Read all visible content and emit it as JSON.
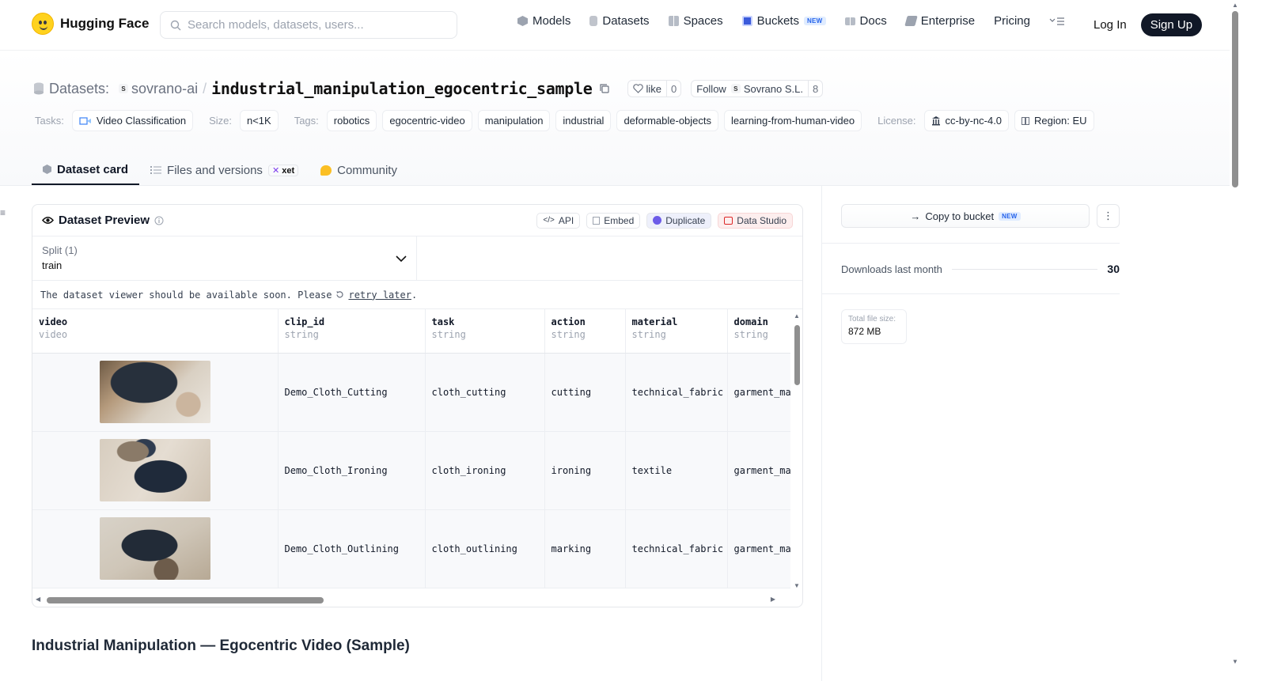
{
  "nav": {
    "brand": "Hugging Face",
    "search_placeholder": "Search models, datasets, users...",
    "items": [
      {
        "label": "Models",
        "icon": "models-icon",
        "color": "#6b7280"
      },
      {
        "label": "Datasets",
        "icon": "datasets-icon",
        "color": "#9ca3af"
      },
      {
        "label": "Spaces",
        "icon": "spaces-icon",
        "color": "#9ca3af"
      },
      {
        "label": "Buckets",
        "icon": "buckets-icon",
        "color": "#3b5bdb",
        "badge": "NEW"
      },
      {
        "label": "Docs",
        "icon": "docs-icon",
        "color": "#9ca3af"
      },
      {
        "label": "Enterprise",
        "icon": "enterprise-icon",
        "color": "#6b7280"
      },
      {
        "label": "Pricing"
      }
    ],
    "login": "Log In",
    "signup": "Sign Up"
  },
  "repo": {
    "kind_label": "Datasets:",
    "org": "sovrano-ai",
    "org_avatar": "S",
    "name": "industrial_manipulation_egocentric_sample",
    "like_label": "like",
    "like_count": "0",
    "follow_label": "Follow",
    "follow_org": "Sovrano S.L.",
    "follow_count": "8"
  },
  "tags": {
    "tasks_label": "Tasks:",
    "task": "Video Classification",
    "size_label": "Size:",
    "size": "n<1K",
    "tags_label": "Tags:",
    "tags": [
      "robotics",
      "egocentric-video",
      "manipulation",
      "industrial",
      "deformable-objects",
      "learning-from-human-video"
    ],
    "license_label": "License:",
    "license": "cc-by-nc-4.0",
    "region": "Region: EU"
  },
  "tabs": [
    {
      "label": "Dataset card",
      "icon": "dataset-card-icon"
    },
    {
      "label": "Files and versions",
      "icon": "files-icon",
      "badge": "xet"
    },
    {
      "label": "Community",
      "icon": "community-icon"
    }
  ],
  "preview": {
    "title": "Dataset Preview",
    "actions": [
      "API",
      "Embed",
      "Duplicate",
      "Data Studio"
    ],
    "split_label": "Split (1)",
    "split_value": "train",
    "notice_text": "The dataset viewer should be available soon. Please",
    "notice_link": "retry later",
    "notice_end": ".",
    "columns": [
      {
        "name": "video",
        "type": "video"
      },
      {
        "name": "clip_id",
        "type": "string"
      },
      {
        "name": "task",
        "type": "string"
      },
      {
        "name": "action",
        "type": "string"
      },
      {
        "name": "material",
        "type": "string"
      },
      {
        "name": "domain",
        "type": "string"
      }
    ],
    "rows": [
      {
        "clip_id": "Demo_Cloth_Cutting",
        "task": "cloth_cutting",
        "action": "cutting",
        "material": "technical_fabric",
        "domain": "garment_ma"
      },
      {
        "clip_id": "Demo_Cloth_Ironing",
        "task": "cloth_ironing",
        "action": "ironing",
        "material": "textile",
        "domain": "garment_ma"
      },
      {
        "clip_id": "Demo_Cloth_Outlining",
        "task": "cloth_outlining",
        "action": "marking",
        "material": "technical_fabric",
        "domain": "garment_ma"
      }
    ]
  },
  "sidebar": {
    "copy_label": "Copy to bucket",
    "copy_badge": "NEW",
    "downloads_label": "Downloads last month",
    "downloads_value": "30",
    "size_label": "Total file size:",
    "size_value": "872 MB"
  },
  "card": {
    "title": "Industrial Manipulation — Egocentric Video (Sample)"
  }
}
